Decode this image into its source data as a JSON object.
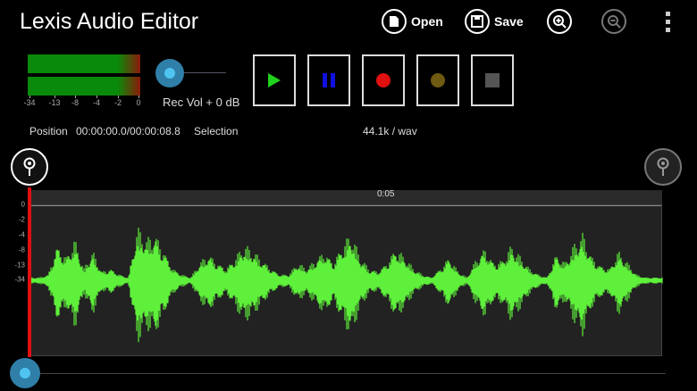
{
  "app": {
    "title": "Lexis Audio Editor"
  },
  "toolbar": {
    "open_label": "Open",
    "save_label": "Save"
  },
  "meter": {
    "ticks": [
      "-34",
      "-13",
      "-8",
      "-4",
      "-2",
      "0"
    ]
  },
  "rec_volume": {
    "label": "Rec Vol + 0 dB",
    "level": 0
  },
  "status": {
    "position_label": "Position",
    "position_value": "00:00:00.0/00:00:08.8",
    "selection_label": "Selection",
    "format": "44.1k / wav"
  },
  "timeline": {
    "marker": "0:05"
  },
  "waveform": {
    "db_labels": [
      "0",
      "-2",
      "-4",
      "-8",
      "-13",
      "-34"
    ],
    "color": "#5ef03a",
    "envelope": [
      0.05,
      0.05,
      0.1,
      0.6,
      0.4,
      0.7,
      0.2,
      0.5,
      0.15,
      0.2,
      0.1,
      0.05,
      0.9,
      0.7,
      0.8,
      0.5,
      0.2,
      0.1,
      0.05,
      0.3,
      0.45,
      0.3,
      0.2,
      0.4,
      0.6,
      0.5,
      0.35,
      0.2,
      0.1,
      0.1,
      0.3,
      0.2,
      0.35,
      0.5,
      0.3,
      0.6,
      0.8,
      0.4,
      0.2,
      0.15,
      0.3,
      0.55,
      0.4,
      0.2,
      0.1,
      0.05,
      0.2,
      0.4,
      0.15,
      0.05,
      0.35,
      0.55,
      0.3,
      0.35,
      0.6,
      0.4,
      0.2,
      0.1,
      0.05,
      0.45,
      0.3,
      0.6,
      0.8,
      0.4,
      0.25,
      0.2,
      0.5,
      0.3,
      0.1,
      0.05,
      0.05,
      0.05
    ],
    "playhead_color": "#e01010"
  },
  "playback_progress": 0
}
